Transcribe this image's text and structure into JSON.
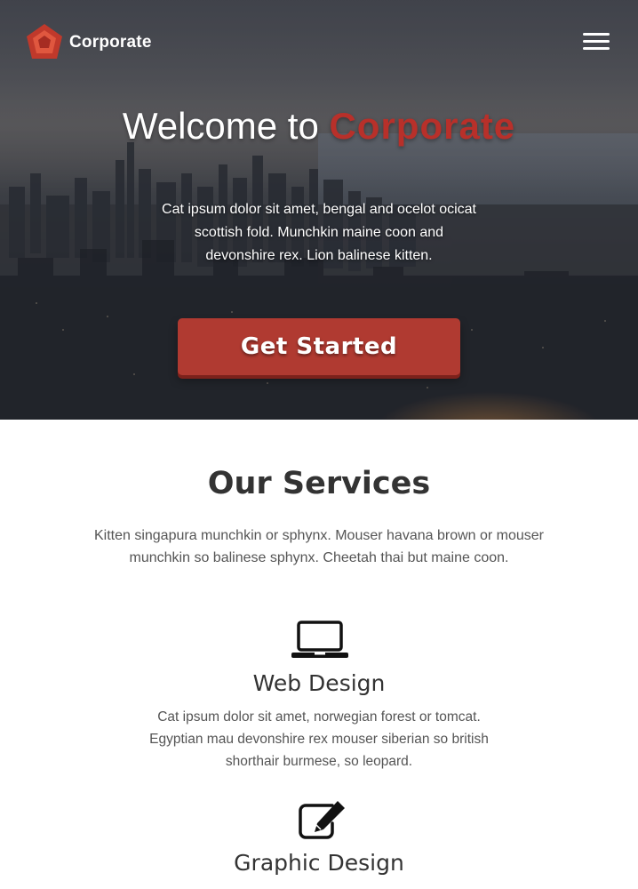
{
  "header": {
    "brand": "Corporate",
    "menu_icon": "hamburger-menu-icon",
    "logo_color": "#c0392b"
  },
  "hero": {
    "title_prefix": "Welcome to ",
    "title_accent": "Corporate",
    "subtitle": "Cat ipsum dolor sit amet, bengal and ocelot ocicat scottish fold. Munchkin maine coon and devonshire rex. Lion balinese kitten.",
    "cta_label": "Get Started"
  },
  "services": {
    "title": "Our Services",
    "subtitle": "Kitten singapura munchkin or sphynx. Mouser havana brown or mouser munchkin so balinese sphynx. Cheetah thai but maine coon.",
    "items": [
      {
        "icon": "laptop-icon",
        "title": "Web Design",
        "description": "Cat ipsum dolor sit amet, norwegian forest or tomcat. Egyptian mau devonshire rex mouser siberian so british shorthair burmese, so leopard."
      },
      {
        "icon": "edit-icon",
        "title": "Graphic Design"
      }
    ]
  },
  "colors": {
    "accent": "#b03a31",
    "text": "#333333"
  }
}
